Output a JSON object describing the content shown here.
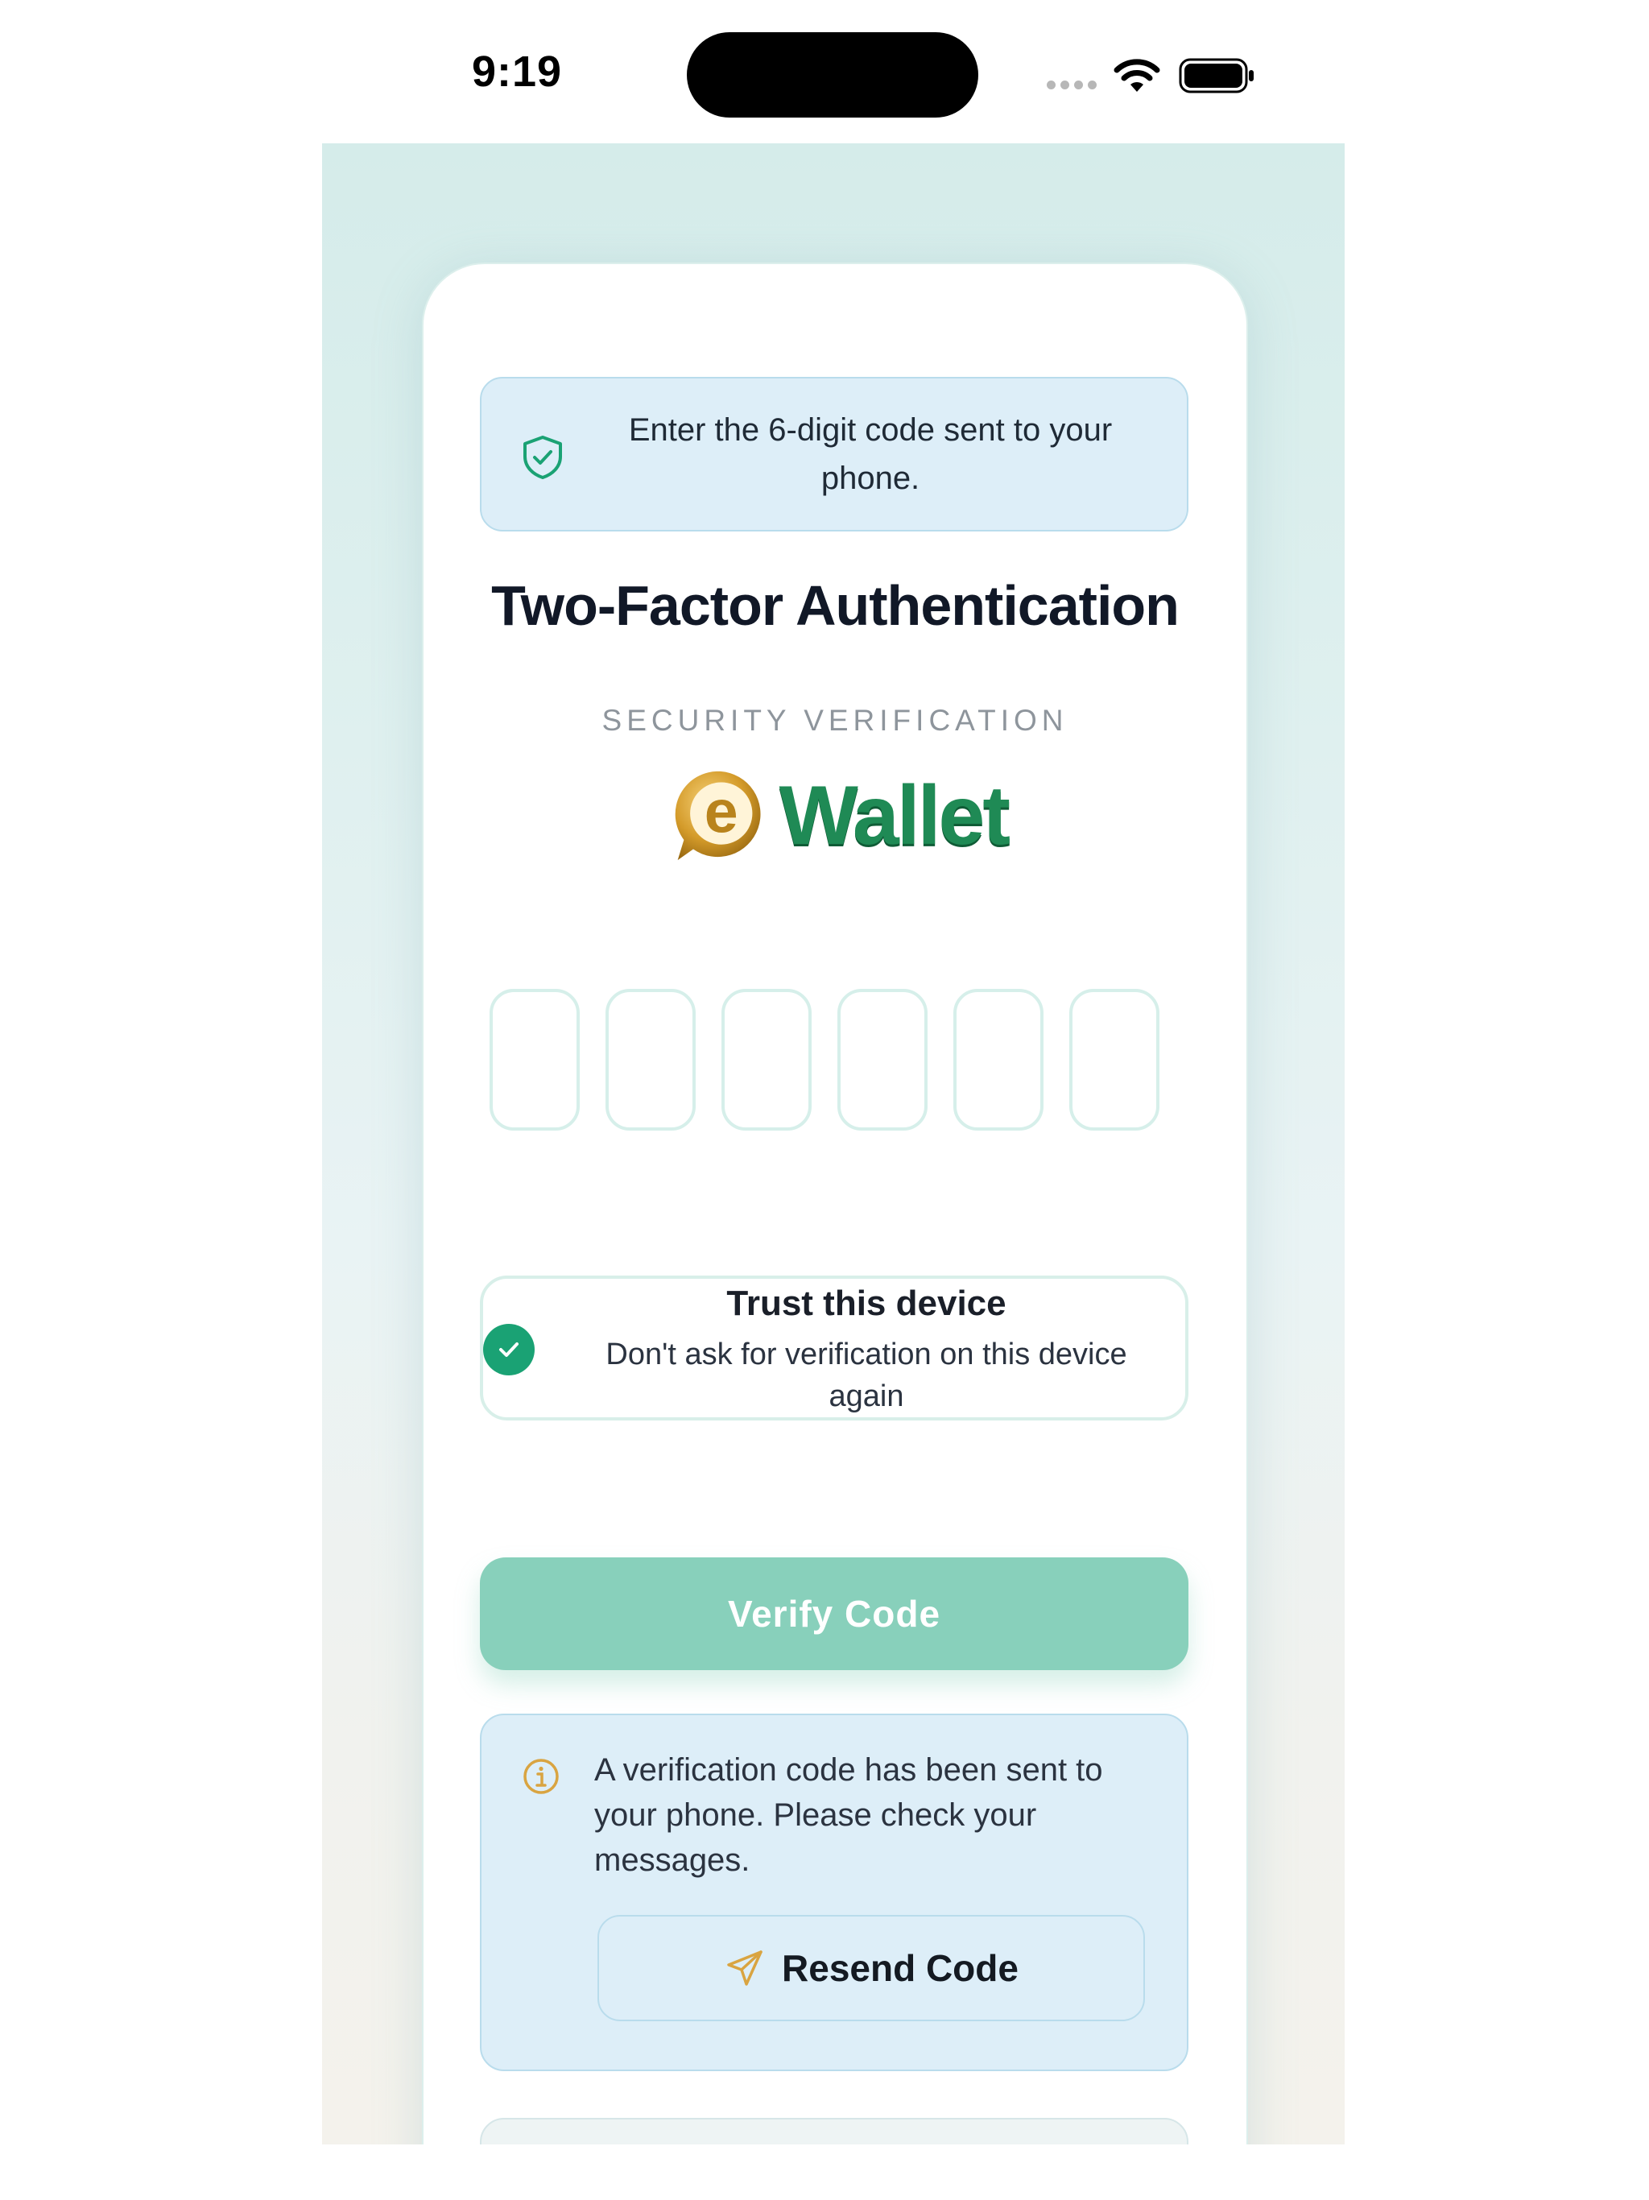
{
  "status_bar": {
    "time": "9:19"
  },
  "banner": {
    "text": "Enter the 6-digit code sent to your phone."
  },
  "title": "Two-Factor Authentication",
  "subtitle": "SECURITY VERIFICATION",
  "logo": {
    "letter": "e",
    "wordmark": "Wallet"
  },
  "otp": {
    "digits": [
      "",
      "",
      "",
      "",
      "",
      ""
    ]
  },
  "trust": {
    "title": "Trust this device",
    "description": "Don't ask for verification on this device again",
    "checked": true
  },
  "verify_button": {
    "label": "Verify Code"
  },
  "notice": {
    "text": "A verification code has been sent to your phone. Please check your messages.",
    "resend_label": "Resend Code"
  },
  "colors": {
    "accent": "#1aa274",
    "button": "#88d0bb",
    "info_bg": "#ddeef8",
    "info_icon": "#d9a441",
    "brand_gold": "#d49b2a",
    "brand_green": "#1f8a55"
  }
}
